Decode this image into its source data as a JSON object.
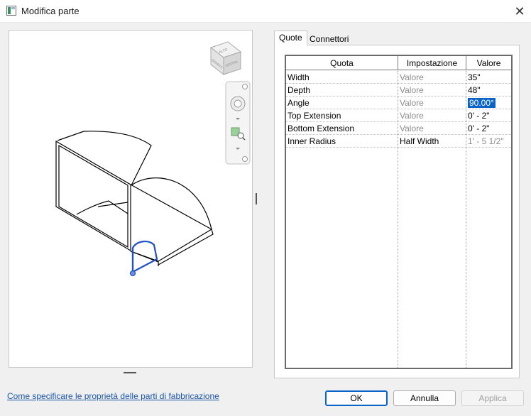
{
  "window": {
    "title": "Modifica parte",
    "close_glyph": "✕"
  },
  "viewcube": {
    "top_label": "ALTO",
    "front_label": "DAVANTI",
    "right_label": "DESTRA"
  },
  "tabs": [
    {
      "label": "Quote",
      "active": true
    },
    {
      "label": "Connettori",
      "active": false
    }
  ],
  "table": {
    "headers": [
      "Quota",
      "Impostazione",
      "Valore"
    ],
    "rows": [
      {
        "quota": "Width",
        "impostazione": "Valore",
        "valore": "35\""
      },
      {
        "quota": "Depth",
        "impostazione": "Valore",
        "valore": "48\""
      },
      {
        "quota": "Angle",
        "impostazione": "Valore",
        "valore": "90.00°"
      },
      {
        "quota": "Top Extension",
        "impostazione": "Valore",
        "valore": "0' - 2\""
      },
      {
        "quota": "Bottom Extension",
        "impostazione": "Valore",
        "valore": "0' - 2\""
      },
      {
        "quota": "Inner Radius",
        "impostazione": "Half Width",
        "valore": "1' - 5 1/2\""
      }
    ]
  },
  "footer": {
    "help_link": "Come specificare le proprietà delle parti di fabbricazione",
    "ok": "OK",
    "cancel": "Annulla",
    "apply": "Applica"
  },
  "colors": {
    "accent": "#0a64c8",
    "connector": "#1f4fc8",
    "link": "#1a56a8"
  },
  "icons": {
    "close": "close-icon",
    "orbit": "steering-wheel-icon",
    "zoom": "zoom-window-icon"
  }
}
